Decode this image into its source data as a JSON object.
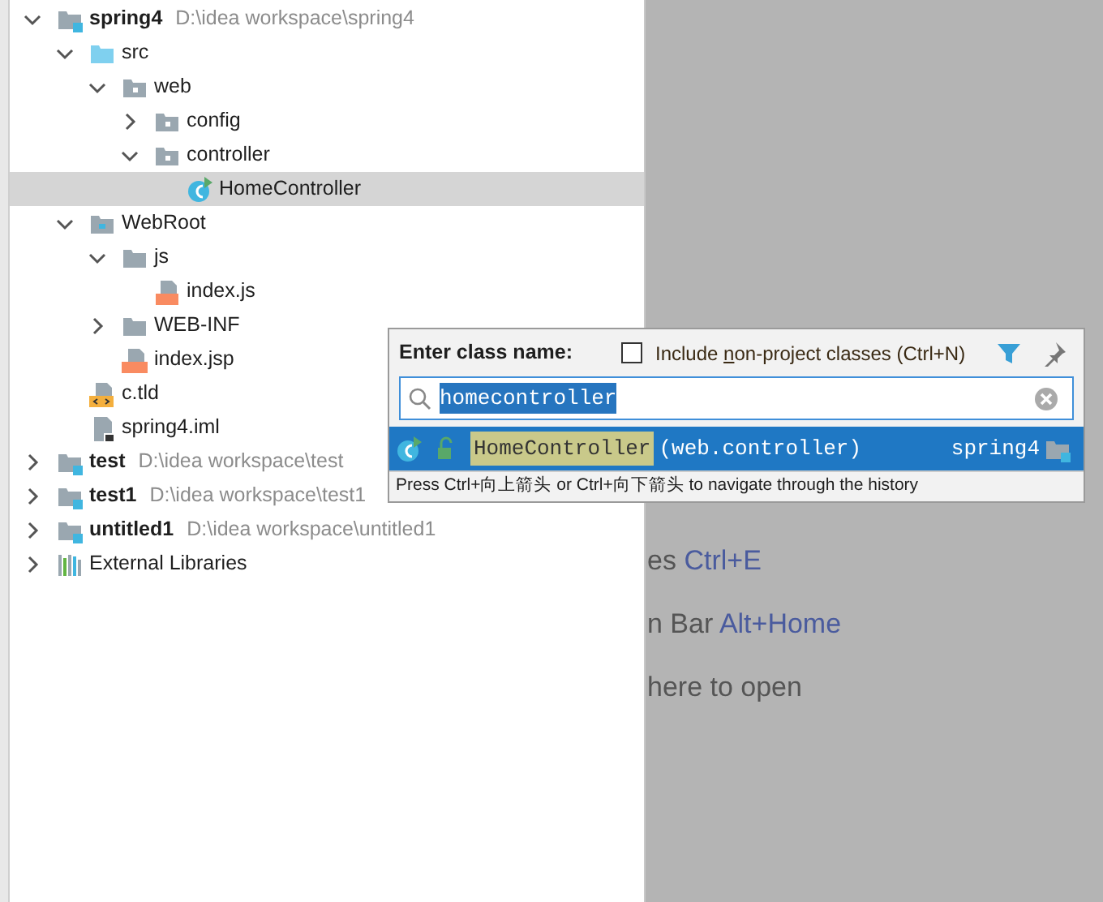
{
  "project_tree": [
    {
      "label": "spring4",
      "path": "D:\\idea workspace\\spring4",
      "kind": "module",
      "expanded": true,
      "selected": false,
      "children": [
        {
          "label": "src",
          "kind": "source-folder",
          "expanded": true,
          "selected": false,
          "children": [
            {
              "label": "web",
              "kind": "package",
              "expanded": true,
              "selected": false,
              "children": [
                {
                  "label": "config",
                  "kind": "package",
                  "expanded": false,
                  "selected": false
                },
                {
                  "label": "controller",
                  "kind": "package",
                  "expanded": true,
                  "selected": false,
                  "children": [
                    {
                      "label": "HomeController",
                      "kind": "java-class",
                      "selected": true
                    }
                  ]
                }
              ]
            }
          ]
        },
        {
          "label": "WebRoot",
          "kind": "web-folder",
          "expanded": true,
          "selected": false,
          "children": [
            {
              "label": "js",
              "kind": "folder",
              "expanded": true,
              "selected": false,
              "children": [
                {
                  "label": "index.js",
                  "kind": "js-file",
                  "selected": false
                }
              ]
            },
            {
              "label": "WEB-INF",
              "kind": "folder",
              "expanded": false,
              "selected": false
            },
            {
              "label": "index.jsp",
              "kind": "jsp-file",
              "selected": false
            }
          ]
        },
        {
          "label": "c.tld",
          "kind": "tld-file",
          "selected": false
        },
        {
          "label": "spring4.iml",
          "kind": "iml-file",
          "selected": false
        }
      ]
    },
    {
      "label": "test",
      "path": "D:\\idea workspace\\test",
      "kind": "module",
      "expanded": false,
      "selected": false
    },
    {
      "label": "test1",
      "path": "D:\\idea workspace\\test1",
      "kind": "module",
      "expanded": false,
      "selected": false
    },
    {
      "label": "untitled1",
      "path": "D:\\idea workspace\\untitled1",
      "kind": "module",
      "expanded": false,
      "selected": false
    },
    {
      "label": "External Libraries",
      "kind": "libraries",
      "expanded": false,
      "selected": false
    }
  ],
  "editor_hints": [
    {
      "text": "es",
      "shortcut": "Ctrl+E"
    },
    {
      "text": "n Bar",
      "shortcut": "Alt+Home"
    },
    {
      "text": "here to open"
    }
  ],
  "class_search_popup": {
    "title": "Enter class name:",
    "include_option": {
      "label_before": "Include ",
      "mnemonic": "n",
      "label_after": "on-project classes (Ctrl+N)",
      "checked": false
    },
    "search_value": "homecontroller",
    "results": [
      {
        "name": "HomeController",
        "package": "(web.controller)",
        "module": "spring4",
        "selected": true
      }
    ],
    "hint": "Press Ctrl+向上箭头 or Ctrl+向下箭头 to navigate through the history"
  }
}
